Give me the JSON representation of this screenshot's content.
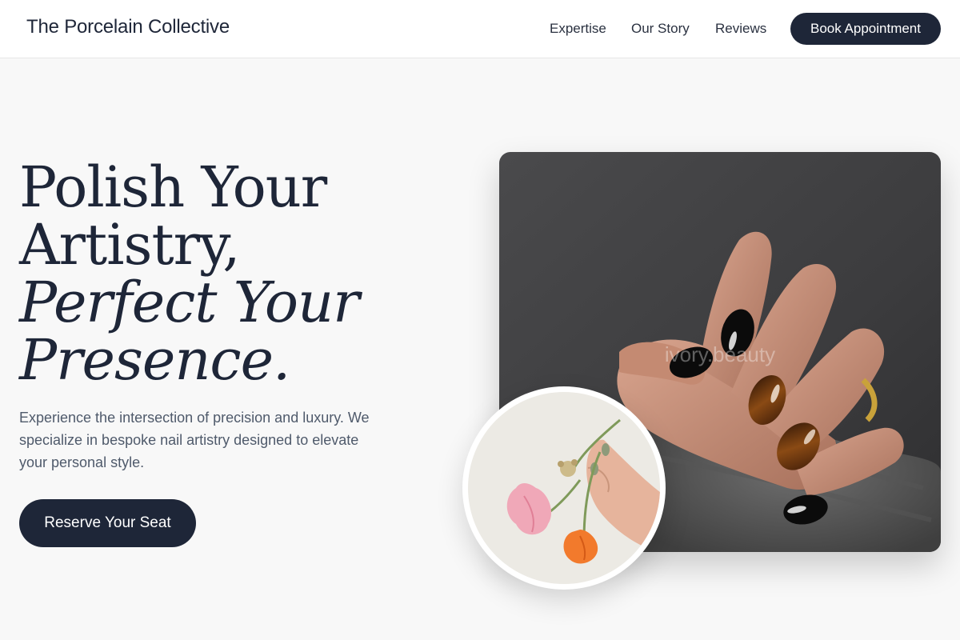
{
  "brand": {
    "name": "The Porcelain Collective"
  },
  "nav": {
    "links": [
      "Expertise",
      "Our Story",
      "Reviews"
    ],
    "cta_label": "Book Appointment"
  },
  "hero": {
    "title_lines": [
      "Polish Your",
      "Artistry,",
      "Perfect Your",
      "Presence."
    ],
    "description": "Experience the intersection of precision and luxury. We specialize in bespoke nail artistry designed to elevate your personal style.",
    "cta_label": "Reserve Your Seat"
  },
  "images": {
    "main_photo": {
      "subject": "hand-with-black-and-tortoiseshell-nails",
      "watermark": "ivory.beauty"
    },
    "circle_photo": {
      "subject": "hand-holding-pink-and-orange-flowers"
    }
  },
  "colors": {
    "primary": "#1e2638",
    "background": "#f8f8f8",
    "header_bg": "#ffffff",
    "body_text": "#4f5a6b"
  }
}
